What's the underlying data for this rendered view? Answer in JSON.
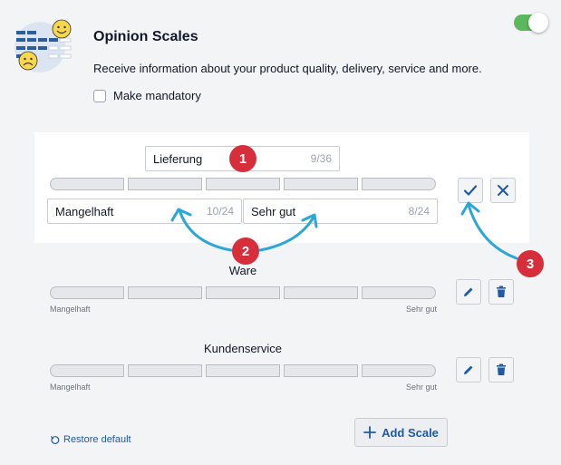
{
  "header": {
    "title": "Opinion Scales",
    "description": "Receive information about your product quality, delivery, service and more.",
    "mandatory_label": "Make mandatory",
    "mandatory_checked": false,
    "enabled": true
  },
  "editor": {
    "name_value": "Lieferung",
    "name_count": "9/36",
    "left_value": "Mangelhaft",
    "left_count": "10/24",
    "right_value": "Sehr gut",
    "right_count": "8/24"
  },
  "scales": [
    {
      "name": "Ware",
      "left": "Mangelhaft",
      "right": "Sehr gut"
    },
    {
      "name": "Kundenservice",
      "left": "Mangelhaft",
      "right": "Sehr gut"
    }
  ],
  "footer": {
    "restore_label": "Restore default",
    "add_label": "Add Scale"
  },
  "annotations": [
    "1",
    "2",
    "3"
  ],
  "colors": {
    "accent": "#1e5aa8",
    "toggle": "#5cb85c",
    "badge": "#d62e3a",
    "arrow": "#2aa7d6"
  },
  "icons": [
    "survey-logo-icon",
    "check-icon",
    "close-icon",
    "pencil-icon",
    "trash-icon",
    "restore-icon",
    "plus-icon"
  ]
}
